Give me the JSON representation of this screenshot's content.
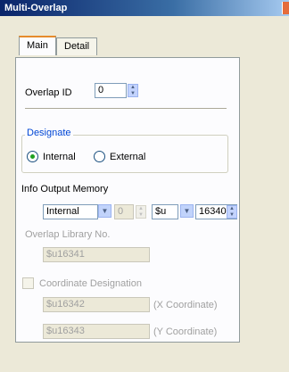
{
  "window": {
    "title": "Multi-Overlap"
  },
  "tabs": {
    "main": "Main",
    "detail": "Detail"
  },
  "overlap_id": {
    "label": "Overlap ID",
    "value": "0"
  },
  "designate": {
    "title": "Designate",
    "internal": "Internal",
    "external": "External",
    "selected": "Internal"
  },
  "info_output": {
    "label": "Info Output Memory",
    "memory_select": "Internal",
    "channel_value": "0",
    "device_select": "$u",
    "address_value": "16340"
  },
  "library": {
    "label": "Overlap Library No.",
    "value": "$u16341"
  },
  "coordinate": {
    "label": "Coordinate Designation",
    "x_value": "$u16342",
    "x_label": "(X Coordinate)",
    "y_value": "$u16343",
    "y_label": "(Y Coordinate)"
  },
  "colors": {
    "title_bar": "#0a246a",
    "tab_highlight": "#e68b2c",
    "group_title": "#0046d5"
  }
}
